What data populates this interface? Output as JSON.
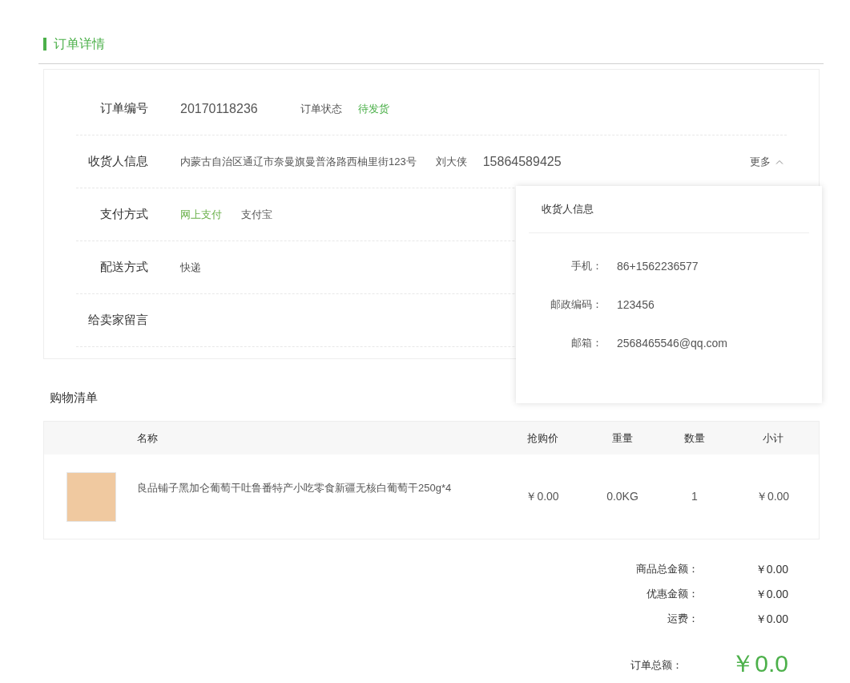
{
  "title": "订单详情",
  "info_rows": [
    {
      "kind": "order",
      "label": "订单编号",
      "number": "20170118236",
      "status_label": "订单状态",
      "status": "待发货"
    },
    {
      "kind": "receiver",
      "label": "收货人信息",
      "address": "内蒙古自治区通辽市奈曼旗曼普洛路西柚里街123号",
      "name": "刘大侠",
      "phone": "15864589425",
      "more": "更多",
      "expanded": true
    },
    {
      "kind": "payment",
      "label": "支付方式",
      "options": [
        {
          "text": "网上支付",
          "selected": true
        },
        {
          "text": "支付宝",
          "selected": false
        }
      ]
    },
    {
      "kind": "plain",
      "label": "配送方式",
      "value": "快递"
    },
    {
      "kind": "plain",
      "label": "给卖家留言"
    }
  ],
  "receiver_popup": {
    "title": "收货人信息",
    "fields": [
      {
        "label": "手机：",
        "value": "86+1562236577"
      },
      {
        "label": "邮政编码：",
        "value": "123456"
      },
      {
        "label": "邮箱：",
        "value": "2568465546@qq.com"
      }
    ]
  },
  "cart": {
    "title": "购物清单",
    "columns": [
      "名称",
      "抢购价",
      "重量",
      "数量",
      "小计"
    ],
    "rows": [
      {
        "name": "良品铺子黑加仑葡萄干吐鲁番特产小吃零食新疆无核白葡萄干250g*4",
        "price": "￥0.00",
        "weight": "0.0KG",
        "quantity": "1",
        "subtotal": "￥0.00"
      }
    ]
  },
  "summary": [
    {
      "label": "商品总金额：",
      "value": "￥0.00"
    },
    {
      "label": "优惠金额：",
      "value": "￥0.00"
    },
    {
      "label": "运费：",
      "value": "￥0.00"
    }
  ],
  "total": {
    "label": "订单总额：",
    "value": "￥0.0"
  }
}
